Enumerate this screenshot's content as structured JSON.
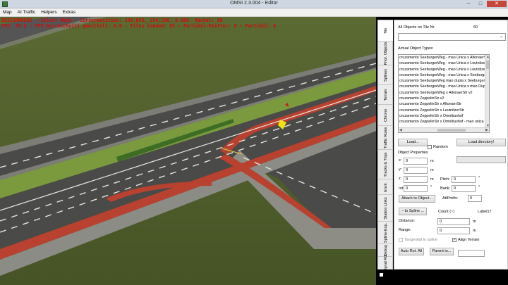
{
  "window": {
    "title": "OMSI 2.3.004 - Editor",
    "controls": {
      "minimize": "─",
      "maximize": "□",
      "close": "✕"
    }
  },
  "menu": [
    "Map",
    "AI Traffic",
    "Helpers",
    "Extras"
  ],
  "hud": {
    "line1": "DESIGNMODUS - Select Mode - Cursorposition: 249.095, 254.286, 0.000, Kachel: 60",
    "line2": "FPS: 59.8 - FPS-Durchschnitt gemittelt: 0.0 - Tiles loaded: 65 - Partikel-Emitter: 0 - Partikel: 0"
  },
  "tabs": [
    {
      "label": "Tile"
    },
    {
      "label": "Prior. Objects"
    },
    {
      "label": "Splines"
    },
    {
      "label": "Terrain"
    },
    {
      "label": "Chrono"
    },
    {
      "label": "Traffic Rules"
    },
    {
      "label": "Tracks & Trips"
    },
    {
      "label": "Envir."
    },
    {
      "label": "Station Links"
    },
    {
      "label": "Spline-Exp."
    },
    {
      "label": "Debug"
    },
    {
      "label": "Signal Rts"
    }
  ],
  "panel": {
    "all_objects_label": "All Objects on Tile Nr.",
    "tile_number": "60",
    "combo_value": "",
    "actual_types_label": "Actual Object Types:",
    "objects": [
      "cruzamento SeeburgerWeg - mao Unica x AltonaerStr",
      "cruzamento SeeburgerWeg - mao Unica x LeutnitzerStr",
      "cruzamento SeeburgerWeg - mao Unica x LeutnitzerStr",
      "cruzamento SeeburgerWeg - mao Unica x SeeburgerWeg",
      "cruzamento SeeburgerWeg mao dupla x SeeburgerWeg",
      "cruzamento SeeburgerWeg - mao Unica x mao Dupla",
      "cruzamento SeeburgerWeg x AltonaerStr v2",
      "cruzamento ZeppelinStr v2",
      "cruzamento ZeppelinStr x AltonaerStr",
      "cruzamento ZeppelinStr x LeutnitzerStr",
      "cruzamento ZeppelinStr x Omnibushof",
      "cruzamento ZeppelinStr x Omnibushof - mao unica"
    ],
    "load_button": "Load...",
    "random_label": "Random",
    "load_dir_button": "Load directory!",
    "props_label": "Object Properties",
    "x_label": "x:",
    "x_value": "0",
    "y_label": "y:",
    "y_value": "0",
    "z_label": "z:",
    "z_value": "0",
    "rot_label": "rot:",
    "rot_value": "0",
    "unit_m": "m",
    "unit_deg": "°",
    "pitch_label": "Pitch:",
    "pitch_value": "0",
    "bank_label": "Bank:",
    "bank_value": "0",
    "attach_button": "Attach to Object...",
    "attprefix_label": "AttPrefix:",
    "attprefix_value": "0",
    "to_spline_button": "~ to Spline ...",
    "count_label": "Count (~)",
    "count_value": "Label17",
    "distance_label": "Distance:",
    "distance_value": "0",
    "range_label": "Range:",
    "range_value": "0",
    "tangential_label": "Tangential to spline",
    "align_terrain_label": "Align Terrain",
    "auto_rot_button": "Auto Rot. All",
    "parent_button": "Parent to..."
  }
}
